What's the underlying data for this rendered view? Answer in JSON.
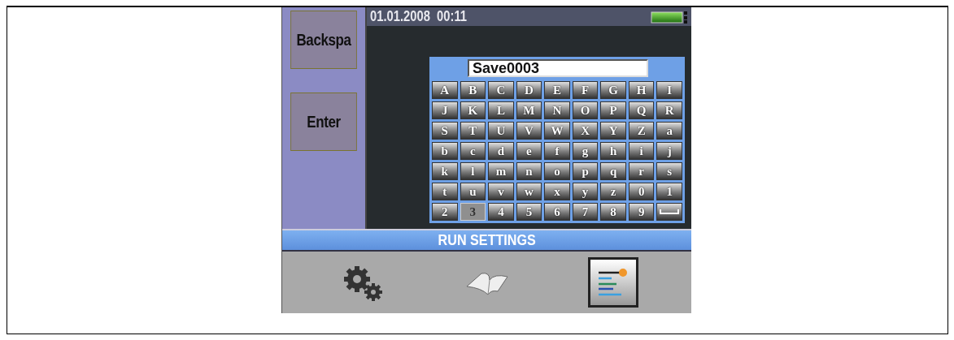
{
  "status_bar": {
    "datetime": "01.01.2008  00:11"
  },
  "side_buttons": [
    {
      "label": "Backspa"
    },
    {
      "label": "Enter"
    }
  ],
  "keyboard": {
    "value": "Save0003",
    "keys": [
      {
        "kind": "char",
        "label": "A",
        "selected": false
      },
      {
        "kind": "char",
        "label": "B",
        "selected": false
      },
      {
        "kind": "char",
        "label": "C",
        "selected": false
      },
      {
        "kind": "char",
        "label": "D",
        "selected": false
      },
      {
        "kind": "char",
        "label": "E",
        "selected": false
      },
      {
        "kind": "char",
        "label": "F",
        "selected": false
      },
      {
        "kind": "char",
        "label": "G",
        "selected": false
      },
      {
        "kind": "char",
        "label": "H",
        "selected": false
      },
      {
        "kind": "char",
        "label": "I",
        "selected": false
      },
      {
        "kind": "char",
        "label": "J",
        "selected": false
      },
      {
        "kind": "char",
        "label": "K",
        "selected": false
      },
      {
        "kind": "char",
        "label": "L",
        "selected": false
      },
      {
        "kind": "char",
        "label": "M",
        "selected": false
      },
      {
        "kind": "char",
        "label": "N",
        "selected": false
      },
      {
        "kind": "char",
        "label": "O",
        "selected": false
      },
      {
        "kind": "char",
        "label": "P",
        "selected": false
      },
      {
        "kind": "char",
        "label": "Q",
        "selected": false
      },
      {
        "kind": "char",
        "label": "R",
        "selected": false
      },
      {
        "kind": "char",
        "label": "S",
        "selected": false
      },
      {
        "kind": "char",
        "label": "T",
        "selected": false
      },
      {
        "kind": "char",
        "label": "U",
        "selected": false
      },
      {
        "kind": "char",
        "label": "V",
        "selected": false
      },
      {
        "kind": "char",
        "label": "W",
        "selected": false
      },
      {
        "kind": "char",
        "label": "X",
        "selected": false
      },
      {
        "kind": "char",
        "label": "Y",
        "selected": false
      },
      {
        "kind": "char",
        "label": "Z",
        "selected": false
      },
      {
        "kind": "char",
        "label": "a",
        "selected": false
      },
      {
        "kind": "char",
        "label": "b",
        "selected": false
      },
      {
        "kind": "char",
        "label": "c",
        "selected": false
      },
      {
        "kind": "char",
        "label": "d",
        "selected": false
      },
      {
        "kind": "char",
        "label": "e",
        "selected": false
      },
      {
        "kind": "char",
        "label": "f",
        "selected": false
      },
      {
        "kind": "char",
        "label": "g",
        "selected": false
      },
      {
        "kind": "char",
        "label": "h",
        "selected": false
      },
      {
        "kind": "char",
        "label": "i",
        "selected": false
      },
      {
        "kind": "char",
        "label": "j",
        "selected": false
      },
      {
        "kind": "char",
        "label": "k",
        "selected": false
      },
      {
        "kind": "char",
        "label": "l",
        "selected": false
      },
      {
        "kind": "char",
        "label": "m",
        "selected": false
      },
      {
        "kind": "char",
        "label": "n",
        "selected": false
      },
      {
        "kind": "char",
        "label": "o",
        "selected": false
      },
      {
        "kind": "char",
        "label": "p",
        "selected": false
      },
      {
        "kind": "char",
        "label": "q",
        "selected": false
      },
      {
        "kind": "char",
        "label": "r",
        "selected": false
      },
      {
        "kind": "char",
        "label": "s",
        "selected": false
      },
      {
        "kind": "char",
        "label": "t",
        "selected": false
      },
      {
        "kind": "char",
        "label": "u",
        "selected": false
      },
      {
        "kind": "char",
        "label": "v",
        "selected": false
      },
      {
        "kind": "char",
        "label": "w",
        "selected": false
      },
      {
        "kind": "char",
        "label": "x",
        "selected": false
      },
      {
        "kind": "char",
        "label": "y",
        "selected": false
      },
      {
        "kind": "char",
        "label": "z",
        "selected": false
      },
      {
        "kind": "char",
        "label": "0",
        "selected": false
      },
      {
        "kind": "char",
        "label": "1",
        "selected": false
      },
      {
        "kind": "char",
        "label": "2",
        "selected": false
      },
      {
        "kind": "char",
        "label": "3",
        "selected": true
      },
      {
        "kind": "char",
        "label": "4",
        "selected": false
      },
      {
        "kind": "char",
        "label": "5",
        "selected": false
      },
      {
        "kind": "char",
        "label": "6",
        "selected": false
      },
      {
        "kind": "char",
        "label": "7",
        "selected": false
      },
      {
        "kind": "char",
        "label": "8",
        "selected": false
      },
      {
        "kind": "char",
        "label": "9",
        "selected": false
      },
      {
        "kind": "space",
        "selected": false
      }
    ]
  },
  "title_bar": {
    "title": "RUN SETTINGS"
  },
  "toolbar": [
    {
      "kind": "gears",
      "selected": false
    },
    {
      "kind": "book",
      "selected": false
    },
    {
      "kind": "list",
      "selected": true
    }
  ]
}
